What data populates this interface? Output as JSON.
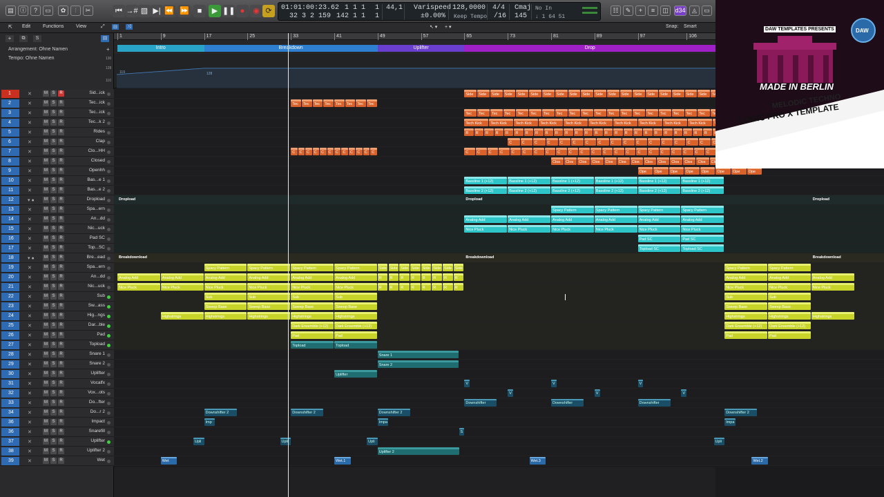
{
  "window": {
    "title": "Logic Pro X — Made in Berlin Melodic Techno Template"
  },
  "transport": {
    "position_time": "01:01:00:23.62",
    "position_bars": "32  3  2 159",
    "locator_left": "1  1  1",
    "locator_right": "142  1  1",
    "loop_l": "1",
    "loop_r": "1",
    "sample_rate": "44,1",
    "varispeed_label": "Varispeed",
    "varispeed_value": "±0.00%",
    "tempo_value": "128,0000",
    "tempo_mode": "Keep Tempo",
    "signature": "4/4",
    "division": "/16",
    "key": "Cmaj",
    "key_num": "145",
    "midi_in": "No In",
    "midi_out": "↓ 1 64 51",
    "cpu_badge": "d34"
  },
  "menubar": {
    "edit": "Edit",
    "functions": "Functions",
    "view": "View",
    "snap_label": "Snap:",
    "snap_value": "Smart"
  },
  "global_tracks": {
    "arrangement_label": "Arrangement: Ohne Namen",
    "tempo_label": "Tempo: Ohne Namen",
    "tempo_scale_top": "130",
    "tempo_scale_mid": "128",
    "tempo_scale_low": "110",
    "tempo_point_a": "119",
    "tempo_point_b": "128"
  },
  "ruler": {
    "bars": [
      "1",
      "9",
      "17",
      "25",
      "33",
      "41",
      "49",
      "57",
      "65",
      "73",
      "81",
      "89",
      "97",
      "106"
    ]
  },
  "arrangement": [
    {
      "name": "Intro",
      "color": "#2aa3c8"
    },
    {
      "name": "Breakdown",
      "color": "#2f7fd1"
    },
    {
      "name": "Uplifter",
      "color": "#6a3fd0"
    },
    {
      "name": "Drop",
      "color": "#a020c8"
    }
  ],
  "tracks": [
    {
      "num": "1",
      "name": "Sid...ick"
    },
    {
      "num": "2",
      "name": "Tec...ick"
    },
    {
      "num": "3",
      "name": "Tec...ick"
    },
    {
      "num": "4",
      "name": "Tec...k 2"
    },
    {
      "num": "5",
      "name": "Rides"
    },
    {
      "num": "6",
      "name": "Clap"
    },
    {
      "num": "7",
      "name": "Clo...HH"
    },
    {
      "num": "8",
      "name": "Closed"
    },
    {
      "num": "9",
      "name": "Openhh"
    },
    {
      "num": "10",
      "name": "Bas...e 1"
    },
    {
      "num": "11",
      "name": "Bas...e 2"
    },
    {
      "num": "12",
      "name": "Dropload"
    },
    {
      "num": "13",
      "name": "Spa...ern"
    },
    {
      "num": "14",
      "name": "An...dd"
    },
    {
      "num": "15",
      "name": "Nic...uck"
    },
    {
      "num": "16",
      "name": "Pad SC"
    },
    {
      "num": "17",
      "name": "Top...SC"
    },
    {
      "num": "18",
      "name": "Bre...ead"
    },
    {
      "num": "19",
      "name": "Spa...ern"
    },
    {
      "num": "20",
      "name": "An...dd"
    },
    {
      "num": "21",
      "name": "Nic...uck"
    },
    {
      "num": "22",
      "name": "Sub"
    },
    {
      "num": "23",
      "name": "Sw...ass"
    },
    {
      "num": "24",
      "name": "Hig...ngs"
    },
    {
      "num": "25",
      "name": "Dar...ble"
    },
    {
      "num": "26",
      "name": "Pad"
    },
    {
      "num": "27",
      "name": "Topload"
    },
    {
      "num": "28",
      "name": "Snare 1"
    },
    {
      "num": "29",
      "name": "Snare 2"
    },
    {
      "num": "30",
      "name": "Uplifter"
    },
    {
      "num": "31",
      "name": "Vocalfx"
    },
    {
      "num": "32",
      "name": "Vox...ots"
    },
    {
      "num": "33",
      "name": "Do...fter"
    },
    {
      "num": "34",
      "name": "Do...r 2"
    },
    {
      "num": "36",
      "name": "Impact"
    },
    {
      "num": "36",
      "name": "Snarefill"
    },
    {
      "num": "37",
      "name": "Uplifter"
    },
    {
      "num": "38",
      "name": "Uplifter 2"
    },
    {
      "num": "39",
      "name": "Wet"
    }
  ],
  "region_labels": {
    "side": "Side",
    "tec": "Tec",
    "tech_kick": "Tech Kick",
    "r": "R",
    "c": "C",
    "clos": "Clos",
    "ope": "Ope",
    "bassline1": "Bassline 1 (+12)",
    "bassline2": "Bassline 2 (+12)",
    "dropload": "Dropload",
    "spacy": "Spacy Pattern",
    "analog": "Analog Add",
    "nice": "Nice Pluck",
    "padsc": "Pad SC",
    "toploadsc": "Topload SC",
    "breakdownload": "Breakdownload",
    "sub": "Sub",
    "sweep": "Sweep Base",
    "highstrings": "Highstrings",
    "dark": "Dark Ensemble (+12)",
    "pad": "Pad",
    "topload": "Topload",
    "snare1": "Snare 1",
    "snare2": "Snare 2",
    "uplifter": "Uplifter",
    "downshifter": "Downshifter",
    "downshifter2": "Downshifter 2",
    "imp": "Imp",
    "impa": "Impa",
    "upli": "Upli",
    "uplifter2": "Uplifter 2",
    "wet": "Wet",
    "wet1": "Wet.1",
    "wet2": "Wet.2",
    "wet3": "Wet.3",
    "v": "V",
    "s": "S"
  },
  "promo": {
    "presents": "DAW TEMPLATES PRESENTS",
    "logo": "DAW",
    "headline": "MADE IN BERLIN",
    "subline1": "MELODIC TECHNO",
    "subline2": "LOGIC PRO X TEMPLATE"
  },
  "colors": {
    "accent_green": "#3fcf3f",
    "record_red": "#c9301f",
    "orange": "#d9622a",
    "cyan": "#2ec5c8",
    "yellow": "#c8d42a"
  }
}
